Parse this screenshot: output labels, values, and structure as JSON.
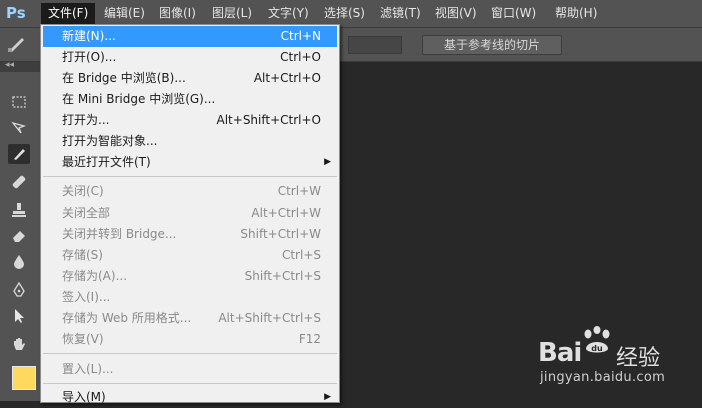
{
  "app": {
    "logo": "Ps"
  },
  "menubar": {
    "items": [
      {
        "label": "文件(F)"
      },
      {
        "label": "编辑(E)"
      },
      {
        "label": "图像(I)"
      },
      {
        "label": "图层(L)"
      },
      {
        "label": "文字(Y)"
      },
      {
        "label": "选择(S)"
      },
      {
        "label": "滤镜(T)"
      },
      {
        "label": "视图(V)"
      },
      {
        "label": "窗口(W)"
      },
      {
        "label": "帮助(H)"
      }
    ]
  },
  "options_bar": {
    "slice_button": "基于参考线的切片"
  },
  "toolbox": {
    "collapse": "◂◂",
    "tools": [
      "marquee-icon",
      "lasso-icon",
      "slice-icon",
      "healing-icon",
      "stamp-icon",
      "eraser-icon",
      "blur-icon",
      "pen-icon",
      "path-select-icon",
      "hand-icon"
    ],
    "foreground_color": "#ffd85f"
  },
  "file_menu": {
    "items": [
      {
        "label": "新建(N)...",
        "shortcut": "Ctrl+N"
      },
      {
        "label": "打开(O)...",
        "shortcut": "Ctrl+O"
      },
      {
        "label": "在 Bridge 中浏览(B)...",
        "shortcut": "Alt+Ctrl+O"
      },
      {
        "label": "在 Mini Bridge 中浏览(G)...",
        "shortcut": ""
      },
      {
        "label": "打开为...",
        "shortcut": "Alt+Shift+Ctrl+O"
      },
      {
        "label": "打开为智能对象...",
        "shortcut": ""
      },
      {
        "label": "最近打开文件(T)",
        "shortcut": ""
      },
      {
        "label": "关闭(C)",
        "shortcut": "Ctrl+W"
      },
      {
        "label": "关闭全部",
        "shortcut": "Alt+Ctrl+W"
      },
      {
        "label": "关闭并转到 Bridge...",
        "shortcut": "Shift+Ctrl+W"
      },
      {
        "label": "存储(S)",
        "shortcut": "Ctrl+S"
      },
      {
        "label": "存储为(A)...",
        "shortcut": "Shift+Ctrl+S"
      },
      {
        "label": "签入(I)...",
        "shortcut": ""
      },
      {
        "label": "存储为 Web 所用格式...",
        "shortcut": "Alt+Shift+Ctrl+S"
      },
      {
        "label": "恢复(V)",
        "shortcut": "F12"
      },
      {
        "label": "置入(L)...",
        "shortcut": ""
      },
      {
        "label": "导入(M)",
        "shortcut": ""
      }
    ],
    "submenu_arrow": "▶"
  },
  "watermark": {
    "logo_left": "Bai",
    "logo_right": "经验",
    "url": "jingyan.baidu.com"
  },
  "colors": {
    "menu_highlight": "#3399ff",
    "ui_gray": "#535353",
    "canvas_bg": "#282828"
  }
}
